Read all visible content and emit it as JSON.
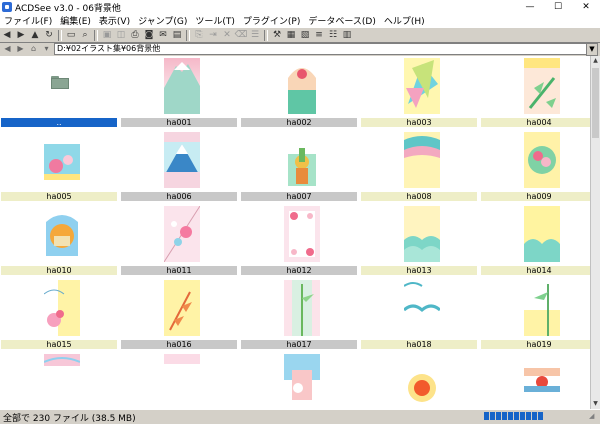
{
  "window": {
    "title": "ACDSee v3.0 - 06背景他",
    "controls": [
      "—",
      "☐",
      "✕"
    ]
  },
  "menu": [
    "ファイル(F)",
    "編集(E)",
    "表示(V)",
    "ジャンプ(G)",
    "ツール(T)",
    "プラグイン(P)",
    "データベース(D)",
    "ヘルプ(H)"
  ],
  "toolbar": {
    "buttons": [
      {
        "name": "back-button",
        "glyph": "◀",
        "disabled": false
      },
      {
        "name": "forward-button",
        "glyph": "▶",
        "disabled": false
      },
      {
        "name": "up-folder-button",
        "glyph": "▲",
        "disabled": false
      },
      {
        "name": "refresh-button",
        "glyph": "↻",
        "disabled": false
      },
      {
        "name": "sep",
        "glyph": "",
        "disabled": false
      },
      {
        "name": "folder-button",
        "glyph": "▭",
        "disabled": false
      },
      {
        "name": "find-button",
        "glyph": "⌕",
        "disabled": false
      },
      {
        "name": "sep",
        "glyph": "",
        "disabled": false
      },
      {
        "name": "view-button",
        "glyph": "▣",
        "disabled": true
      },
      {
        "name": "wallpaper-button",
        "glyph": "◫",
        "disabled": true
      },
      {
        "name": "print-button",
        "glyph": "⎙",
        "disabled": false
      },
      {
        "name": "scan-button",
        "glyph": "◙",
        "disabled": false
      },
      {
        "name": "mail-button",
        "glyph": "✉",
        "disabled": false
      },
      {
        "name": "slide-button",
        "glyph": "▤",
        "disabled": false
      },
      {
        "name": "sep",
        "glyph": "",
        "disabled": false
      },
      {
        "name": "copy-button",
        "glyph": "⎘",
        "disabled": true
      },
      {
        "name": "move-button",
        "glyph": "⇥",
        "disabled": true
      },
      {
        "name": "delete-button",
        "glyph": "✕",
        "disabled": true
      },
      {
        "name": "rename-button",
        "glyph": "⌫",
        "disabled": true
      },
      {
        "name": "properties-button",
        "glyph": "☰",
        "disabled": true
      },
      {
        "name": "sep",
        "glyph": "",
        "disabled": false
      },
      {
        "name": "tools-button",
        "glyph": "⚒",
        "disabled": false
      },
      {
        "name": "thumbnail-view-button",
        "glyph": "▦",
        "disabled": false
      },
      {
        "name": "large-icons-button",
        "glyph": "▧",
        "disabled": false
      },
      {
        "name": "list-view-button",
        "glyph": "≡",
        "disabled": false
      },
      {
        "name": "details-view-button",
        "glyph": "☷",
        "disabled": false
      },
      {
        "name": "grid-view-button",
        "glyph": "▥",
        "disabled": false
      }
    ]
  },
  "path": {
    "value": "D:¥02イラスト集¥06背景他"
  },
  "files": [
    {
      "name": "..",
      "type": "folder",
      "selected": true
    },
    {
      "name": "ha001",
      "type": "img",
      "theme": "fuji"
    },
    {
      "name": "ha002",
      "type": "img",
      "theme": "sun"
    },
    {
      "name": "ha003",
      "type": "img",
      "theme": "fan"
    },
    {
      "name": "ha004",
      "type": "img",
      "theme": "bamboo"
    },
    {
      "name": "ha005",
      "type": "img",
      "theme": "plum"
    },
    {
      "name": "ha006",
      "type": "img",
      "theme": "fuji2"
    },
    {
      "name": "ha007",
      "type": "img",
      "theme": "pine"
    },
    {
      "name": "ha008",
      "type": "img",
      "theme": "cloud"
    },
    {
      "name": "ha009",
      "type": "img",
      "theme": "flower"
    },
    {
      "name": "ha010",
      "type": "img",
      "theme": "kagami"
    },
    {
      "name": "ha011",
      "type": "img",
      "theme": "plum2"
    },
    {
      "name": "ha012",
      "type": "img",
      "theme": "frame"
    },
    {
      "name": "ha013",
      "type": "img",
      "theme": "wave"
    },
    {
      "name": "ha014",
      "type": "img",
      "theme": "wave2"
    },
    {
      "name": "ha015",
      "type": "img",
      "theme": "plum3"
    },
    {
      "name": "ha016",
      "type": "img",
      "theme": "leaves"
    },
    {
      "name": "ha017",
      "type": "img",
      "theme": "bamboo2"
    },
    {
      "name": "ha018",
      "type": "img",
      "theme": "wave3"
    },
    {
      "name": "ha019",
      "type": "img",
      "theme": "bamboo3"
    },
    {
      "name": "",
      "type": "img",
      "theme": "pinkwave"
    },
    {
      "name": "",
      "type": "img",
      "theme": "pinkplain"
    },
    {
      "name": "",
      "type": "img",
      "theme": "sunrise"
    },
    {
      "name": "",
      "type": "img",
      "theme": "sunburst"
    },
    {
      "name": "",
      "type": "img",
      "theme": "redsun"
    }
  ],
  "status": {
    "text": "全部で 230 ファイル (38.5 MB)"
  },
  "colors": {
    "selection": "#1664c8",
    "caption": "#eeeec7",
    "progress": "#1664c8"
  }
}
